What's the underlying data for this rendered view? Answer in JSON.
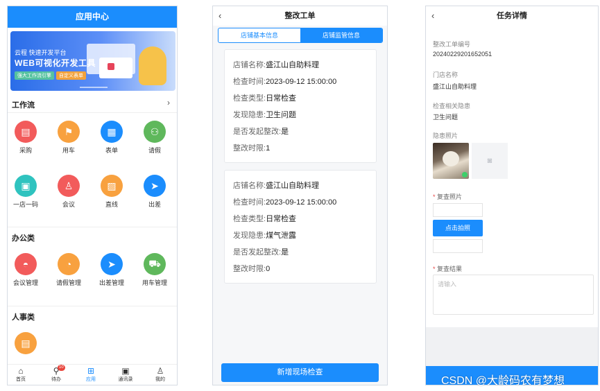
{
  "app_center": {
    "title": "应用中心",
    "banner": {
      "line1": "云程 快速开发平台",
      "line2": "WEB可视化开发工具",
      "tag1": "强大工作流引擎",
      "tag2": "自定义表单"
    },
    "workflow": {
      "title": "工作流",
      "items": [
        {
          "label": "采购",
          "icon": "doc-icon",
          "color": "#f25b5b",
          "glyph": "▤"
        },
        {
          "label": "用车",
          "icon": "flag-icon",
          "color": "#f8a13f",
          "glyph": "⚑"
        },
        {
          "label": "表单",
          "icon": "form-icon",
          "color": "#1b8dfd",
          "glyph": "▦"
        },
        {
          "label": "请假",
          "icon": "people-icon",
          "color": "#5fb85c",
          "glyph": "⚇"
        },
        {
          "label": "一店一码",
          "icon": "clipboard-icon",
          "color": "#2fc3bf",
          "glyph": "▣"
        },
        {
          "label": "会议",
          "icon": "person-icon",
          "color": "#f25b5b",
          "glyph": "♙"
        },
        {
          "label": "直线",
          "icon": "chart-icon",
          "color": "#f8a13f",
          "glyph": "▨"
        },
        {
          "label": "出差",
          "icon": "plane-icon",
          "color": "#1b8dfd",
          "glyph": "➤"
        }
      ]
    },
    "office": {
      "title": "办公类",
      "items": [
        {
          "label": "会议管理",
          "icon": "helmet-icon",
          "color": "#f25b5b",
          "glyph": "◓"
        },
        {
          "label": "请假管理",
          "icon": "leave-icon",
          "color": "#f8a13f",
          "glyph": "◔"
        },
        {
          "label": "出差管理",
          "icon": "plane-icon",
          "color": "#1b8dfd",
          "glyph": "➤"
        },
        {
          "label": "用车管理",
          "icon": "truck-icon",
          "color": "#5fb85c",
          "glyph": "⛟"
        }
      ]
    },
    "hr": {
      "title": "人事类",
      "items": [
        {
          "label": "",
          "icon": "roster-icon",
          "color": "#f8a13f",
          "glyph": "▤"
        }
      ]
    },
    "tabs": [
      {
        "label": "首页",
        "icon": "home-icon",
        "glyph": "⌂"
      },
      {
        "label": "待办",
        "icon": "todo-icon",
        "glyph": "⚲",
        "badge": "10"
      },
      {
        "label": "应用",
        "icon": "apps-icon",
        "glyph": "⊞",
        "active": true
      },
      {
        "label": "通讯录",
        "icon": "contacts-icon",
        "glyph": "▣"
      },
      {
        "label": "我的",
        "icon": "user-icon",
        "glyph": "♙"
      }
    ]
  },
  "rectification": {
    "title": "整改工单",
    "segments": [
      "店铺基本信息",
      "店铺监管信息"
    ],
    "active_segment": 1,
    "cards": [
      {
        "rows": [
          {
            "k": "店铺名称:",
            "v": "盛江山自助料理"
          },
          {
            "k": "检查时间:",
            "v": "2023-09-12 15:00:00"
          },
          {
            "k": "检查类型:",
            "v": "日常检查"
          },
          {
            "k": "发现隐患:",
            "v": "卫生问题"
          },
          {
            "k": "是否发起整改:",
            "v": "是"
          },
          {
            "k": "整改时限:",
            "v": "1"
          }
        ]
      },
      {
        "rows": [
          {
            "k": "店铺名称:",
            "v": "盛江山自助料理"
          },
          {
            "k": "检查时间:",
            "v": "2023-09-12 15:00:00"
          },
          {
            "k": "检查类型:",
            "v": "日常检查"
          },
          {
            "k": "发现隐患:",
            "v": "煤气泄露"
          },
          {
            "k": "是否发起整改:",
            "v": "是"
          },
          {
            "k": "整改时限:",
            "v": "0"
          }
        ]
      }
    ],
    "button": "新增现场检查"
  },
  "task": {
    "title": "任务详情",
    "order_no_label": "整改工单编号",
    "order_no": "20240229201652051",
    "store_label": "门店名称",
    "store": "盛江山自助料理",
    "hazard_label": "检查相关隐患",
    "hazard": "卫生问题",
    "photo_label": "隐患照片",
    "recheck_photo_label": "复查照片",
    "shoot_button": "点击拍照",
    "result_label": "复查结果",
    "result_placeholder": "请输入"
  },
  "watermark": "CSDN @大龄码农有梦想"
}
